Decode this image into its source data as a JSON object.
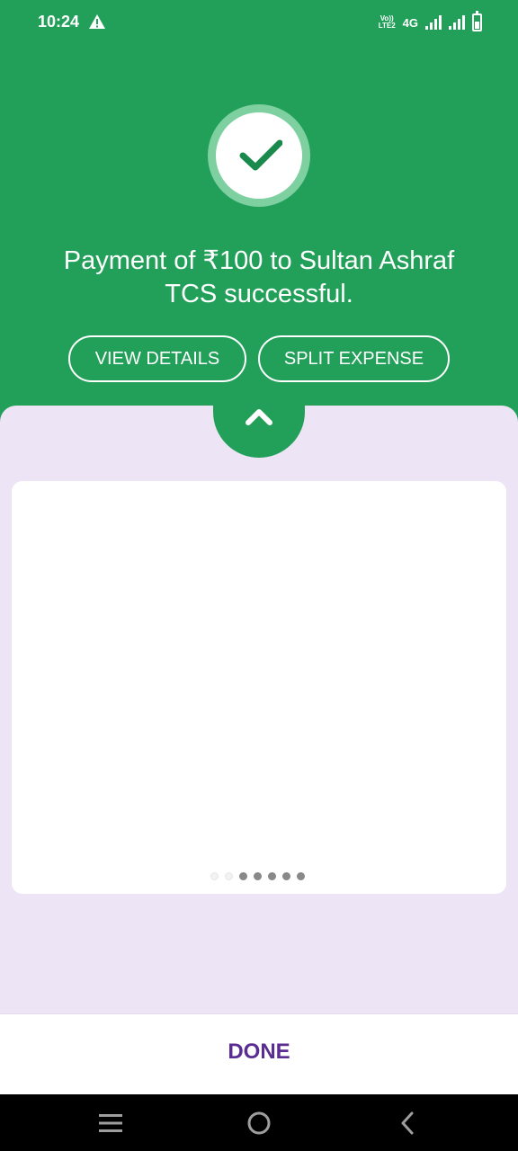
{
  "status_bar": {
    "time": "10:24",
    "volte_line1": "Vo))",
    "volte_line2": "LTE2",
    "network": "4G",
    "warning_icon": "warning-triangle-icon"
  },
  "success": {
    "icon": "checkmark-icon",
    "message": "Payment of ₹100 to Sultan Ashraf TCS successful."
  },
  "actions": {
    "view_details": "VIEW DETAILS",
    "split_expense": "SPLIT EXPENSE"
  },
  "carousel": {
    "page_count": 7,
    "active_page": 1
  },
  "footer": {
    "done_label": "DONE"
  },
  "colors": {
    "primary_green": "#22a05a",
    "lavender_bg": "#ede4f5",
    "done_purple": "#5b2d91",
    "check_green": "#1a8a4c"
  },
  "nav_bar": {
    "icons": [
      "menu-icon",
      "home-icon",
      "back-icon"
    ]
  }
}
